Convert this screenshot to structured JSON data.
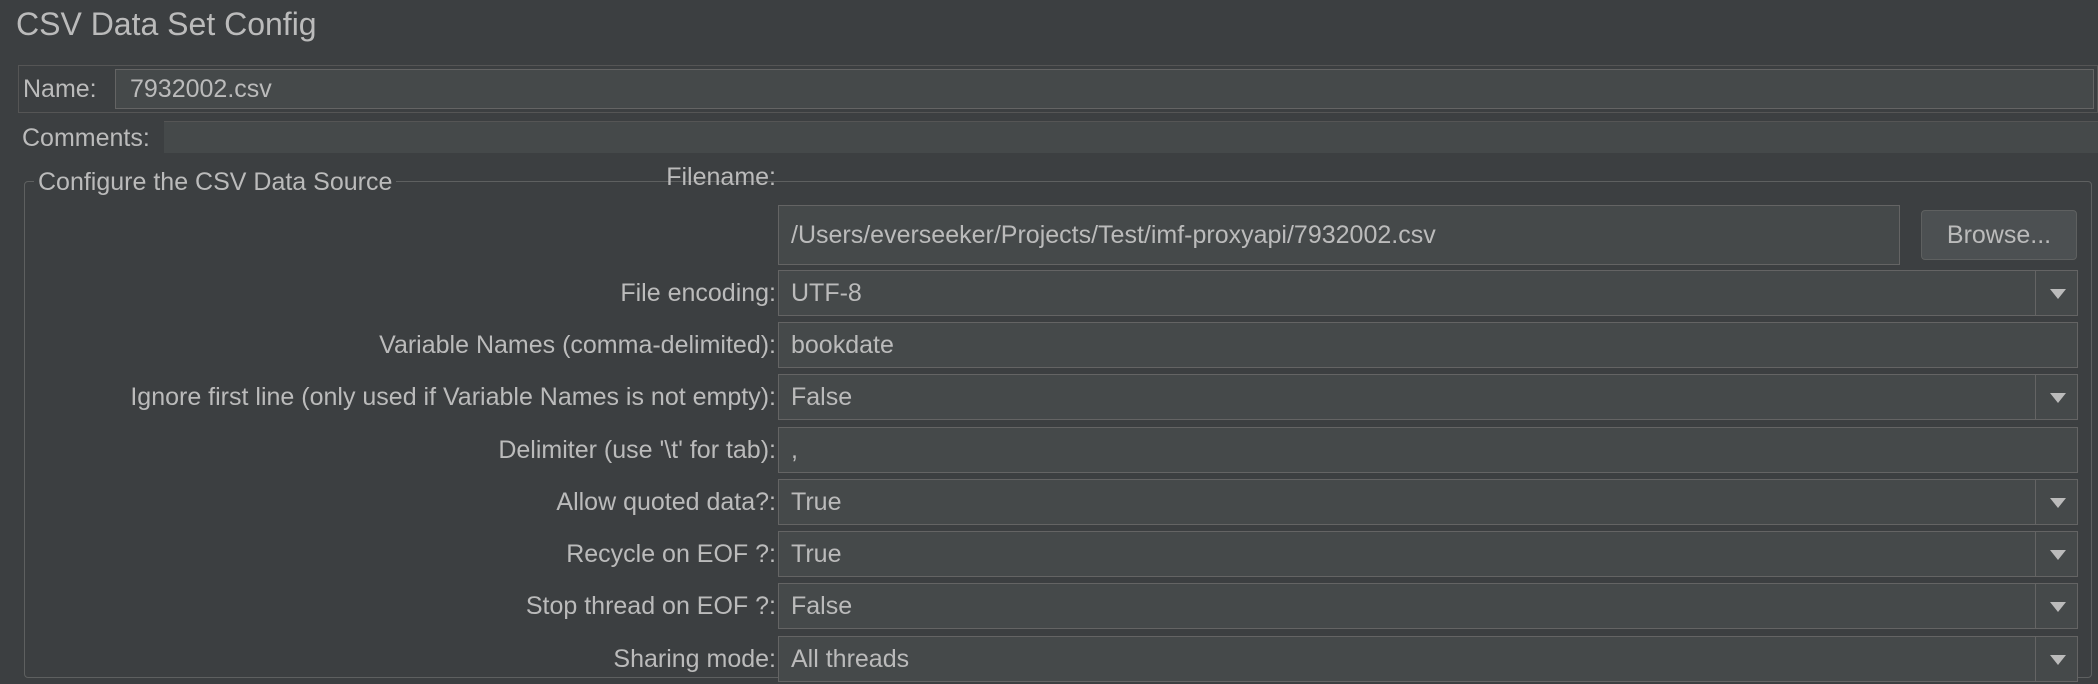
{
  "window": {
    "title": "CSV Data Set Config"
  },
  "name_field": {
    "label": "Name:",
    "value": "7932002.csv"
  },
  "comments_field": {
    "label": "Comments:",
    "value": ""
  },
  "csv_source": {
    "legend": "Configure the CSV Data Source",
    "filename": {
      "label": "Filename:",
      "value": "/Users/everseeker/Projects/Test/imf-proxyapi/7932002.csv",
      "browse_label": "Browse..."
    },
    "file_encoding": {
      "label": "File encoding:",
      "value": "UTF-8"
    },
    "variable_names": {
      "label": "Variable Names (comma-delimited):",
      "value": "bookdate"
    },
    "ignore_first_line": {
      "label": "Ignore first line (only used if Variable Names is not empty):",
      "value": "False"
    },
    "delimiter": {
      "label": "Delimiter (use '\\t' for tab):",
      "value": ","
    },
    "allow_quoted_data": {
      "label": "Allow quoted data?:",
      "value": "True"
    },
    "recycle_on_eof": {
      "label": "Recycle on EOF ?:",
      "value": "True"
    },
    "stop_thread_on_eof": {
      "label": "Stop thread on EOF ?:",
      "value": "False"
    },
    "sharing_mode": {
      "label": "Sharing mode:",
      "value": "All threads"
    }
  },
  "icons": {
    "dropdown": "chevron-down-icon"
  }
}
